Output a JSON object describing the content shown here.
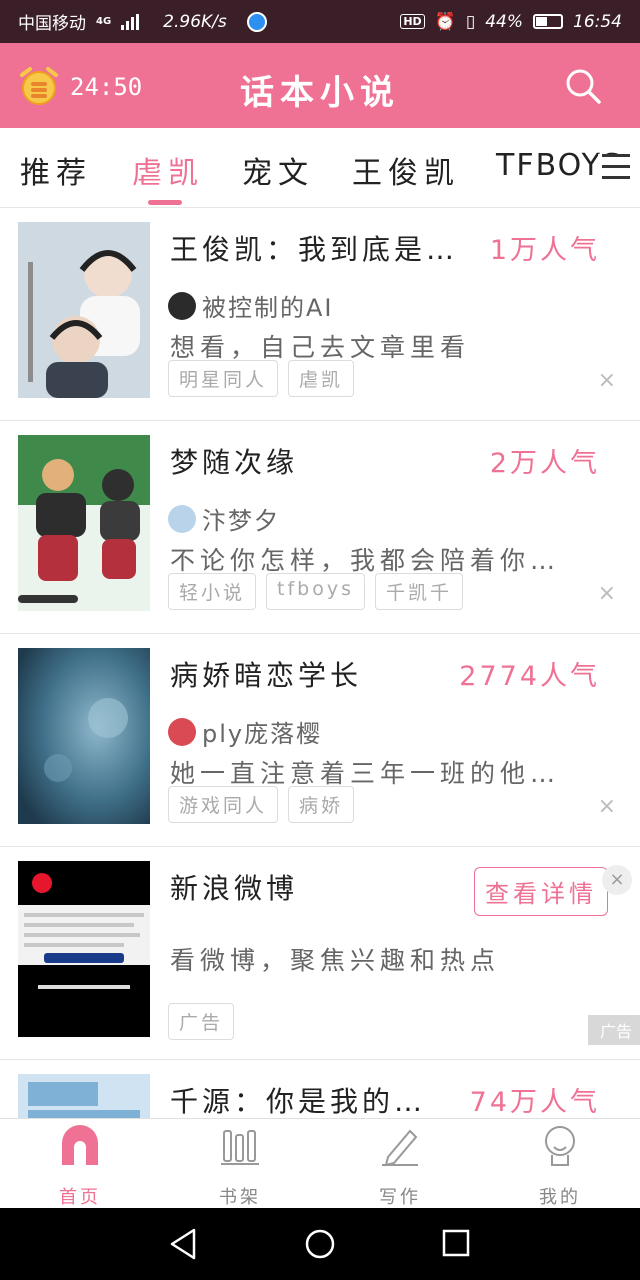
{
  "status_bar": {
    "carrier": "中国移动",
    "network": "4G",
    "speed": "2.96K/s",
    "hd_badge": "HD",
    "battery": "44%",
    "time": "16:54"
  },
  "app_bar": {
    "timer": "24:50",
    "title": "话本小说"
  },
  "tabs": [
    {
      "label": "推荐"
    },
    {
      "label": "虐凯"
    },
    {
      "label": "宠文"
    },
    {
      "label": "王俊凯"
    },
    {
      "label": "TFBOYS"
    }
  ],
  "items": [
    {
      "title": "王俊凯：我到底是…",
      "popularity": "1万人气",
      "author": "被控制的AI",
      "desc": "想看，自己去文章里看",
      "tags": [
        "明星同人",
        "虐凯"
      ],
      "close": "×"
    },
    {
      "title": "梦随次缘",
      "popularity": "2万人气",
      "author": "汴梦夕",
      "desc": "不论你怎样，我都会陪着你…",
      "tags": [
        "轻小说",
        "tfboys",
        "千凯千"
      ],
      "close": "×"
    },
    {
      "title": "病娇暗恋学长",
      "popularity": "2774人气",
      "author": "ply庞落樱",
      "desc": "她一直注意着三年一班的他…",
      "tags": [
        "游戏同人",
        "病娇"
      ],
      "close": "×"
    }
  ],
  "ad": {
    "title": "新浪微博",
    "button": "查看详情",
    "desc": "看微博，聚焦兴趣和热点",
    "tag": "广告",
    "label": "广告",
    "close": "×"
  },
  "partial_item": {
    "title": "千源：你是我的…",
    "popularity": "74万人气"
  },
  "bottom_nav": [
    {
      "label": "首页",
      "icon": "home-icon"
    },
    {
      "label": "书架",
      "icon": "bookshelf-icon"
    },
    {
      "label": "写作",
      "icon": "pen-icon"
    },
    {
      "label": "我的",
      "icon": "profile-icon"
    }
  ],
  "colors": {
    "accent": "#ef7294",
    "status_bar": "#3a1f28"
  }
}
